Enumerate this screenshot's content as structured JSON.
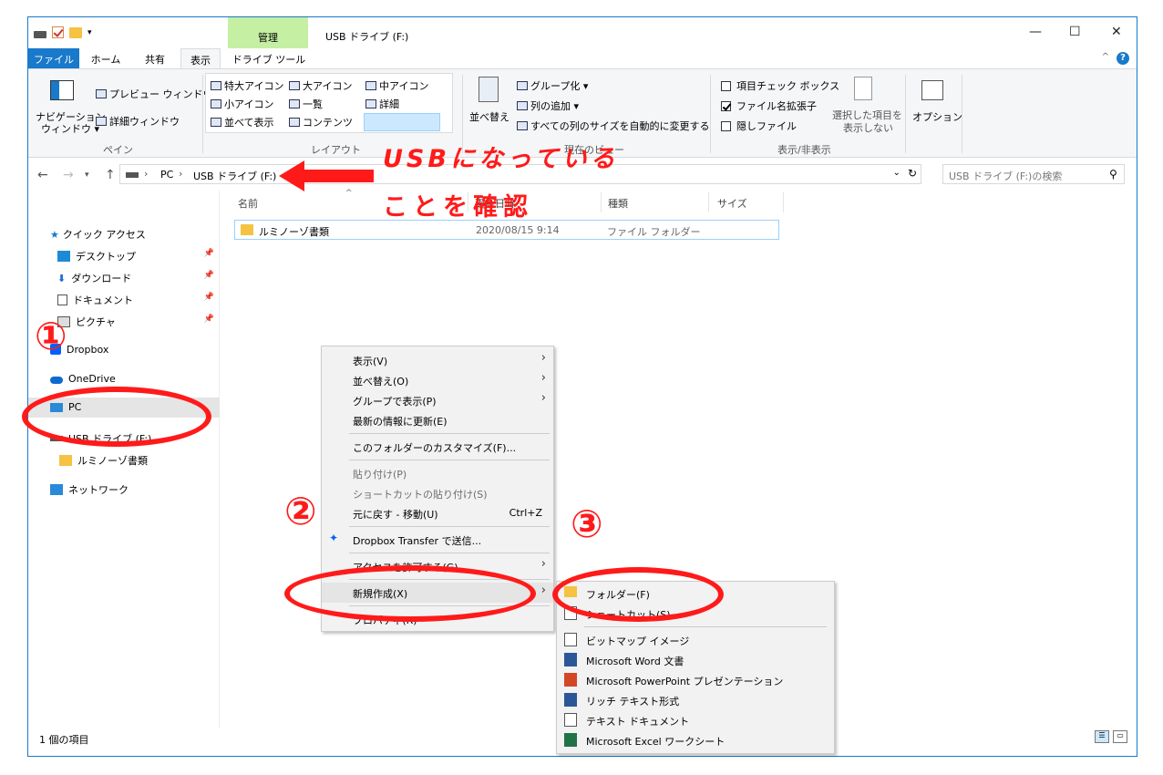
{
  "window": {
    "manage_tab": "管理",
    "title": "USB ドライブ (F:)",
    "min": "—",
    "max": "☐",
    "close": "✕"
  },
  "tabs": [
    "ファイル",
    "ホーム",
    "共有",
    "表示",
    "ドライブ ツール"
  ],
  "ribbon": {
    "pane": {
      "nav_pane": "ナビゲーション",
      "nav_pane2": "ウィンドウ ▾",
      "preview": "プレビュー ウィンドウ",
      "details": "詳細ウィンドウ",
      "group": "ペイン"
    },
    "layout": {
      "xl_icon": "特大アイコン",
      "l_icon": "大アイコン",
      "m_icon": "中アイコン",
      "s_icon": "小アイコン",
      "list": "一覧",
      "detail": "詳細",
      "tiles": "並べて表示",
      "content": "コンテンツ",
      "group": "レイアウト"
    },
    "view": {
      "sort": "並べ替え",
      "group_by": "グループ化 ▾",
      "add_col": "列の追加 ▾",
      "fit_cols": "すべての列のサイズを自動的に変更する",
      "group": "現在のビュー"
    },
    "showhide": {
      "item_cb": "項目チェック ボックス",
      "ext": "ファイル名拡張子",
      "hidden": "隠しファイル",
      "hide_sel": "選択した項目を",
      "hide_sel2": "表示しない",
      "group": "表示/非表示"
    },
    "options": "オプション"
  },
  "address": {
    "path": [
      "PC",
      "USB ドライブ (F:)"
    ],
    "search_placeholder": "USB ドライブ (F:)の検索"
  },
  "nav": {
    "quick": "クイック アクセス",
    "desktop": "デスクトップ",
    "downloads": "ダウンロード",
    "documents": "ドキュメント",
    "pictures": "ピクチャ",
    "dropbox": "Dropbox",
    "onedrive": "OneDrive",
    "pc": "PC",
    "usb": "USB ドライブ (F:)",
    "folder": "ルミノーゾ書類",
    "network": "ネットワーク"
  },
  "columns": [
    "名前",
    "更新日時",
    "種類",
    "サイズ"
  ],
  "files": [
    {
      "name": "ルミノーゾ書類",
      "date": "2020/08/15 9:14",
      "type": "ファイル フォルダー"
    }
  ],
  "status": "1 個の項目",
  "context_menu": {
    "view": "表示(V)",
    "sort": "並べ替え(O)",
    "group": "グループで表示(P)",
    "refresh": "最新の情報に更新(E)",
    "customize": "このフォルダーのカスタマイズ(F)...",
    "paste": "貼り付け(P)",
    "paste_shortcut": "ショートカットの貼り付け(S)",
    "undo": "元に戻す - 移動(U)",
    "undo_key": "Ctrl+Z",
    "dropbox": "Dropbox Transfer で送信...",
    "access": "アクセスを許可する(G)",
    "new": "新規作成(X)",
    "props": "プロパティ(R)"
  },
  "submenu": {
    "folder": "フォルダー(F)",
    "shortcut": "ショートカット(S)",
    "bmp": "ビットマップ イメージ",
    "word": "Microsoft Word 文書",
    "ppt": "Microsoft PowerPoint プレゼンテーション",
    "rtf": "リッチ テキスト形式",
    "txt": "テキスト ドキュメント",
    "excel": "Microsoft Excel ワークシート"
  },
  "annotations": {
    "line1": "USBになっている",
    "line2": "ことを確認",
    "n1": "①",
    "n2": "②",
    "n3": "③"
  }
}
